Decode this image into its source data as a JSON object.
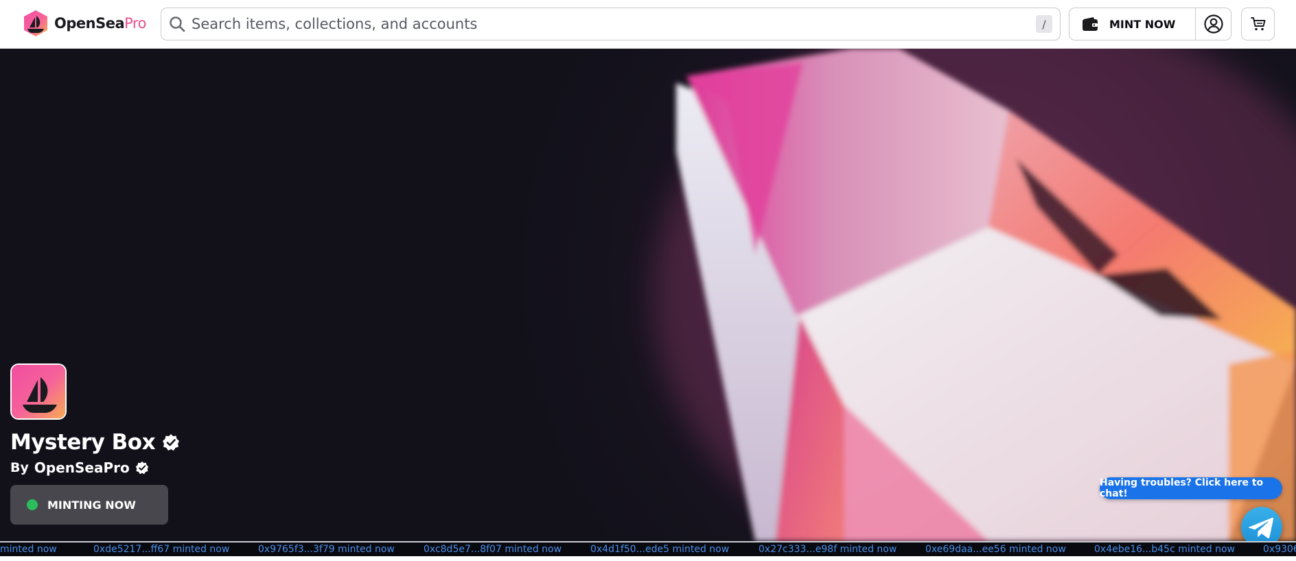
{
  "header": {
    "logo": {
      "brand": "OpenSea",
      "suffix": "Pro"
    },
    "search": {
      "placeholder": "Search items, collections, and accounts",
      "value": "",
      "shortcut": "/"
    },
    "mint_button_label": "MINT NOW",
    "icons": {
      "logo": "opensea-pro-logo",
      "search": "search-icon",
      "wallet": "wallet-icon",
      "account": "account-circle-icon",
      "cart": "cart-icon"
    }
  },
  "hero": {
    "collection_title": "Mystery Box",
    "creator_prefix": "By",
    "creator_name": "OpenSeaPro",
    "status_label": "MINTING NOW",
    "colors": {
      "background": "#12111a",
      "status_dot": "#2bbd5c",
      "status_pill": "#47474d",
      "gem_pink": "#e8509a",
      "gem_orange": "#f59a4a"
    }
  },
  "support": {
    "chat_prompt": "Having troubles? Click here to chat!",
    "chat_color": "#1a73e8",
    "telegram_icon": "telegram-icon"
  },
  "ticker": {
    "color": "#4a8ee8",
    "items": [
      "minted now",
      "0xde5217...ff67 minted now",
      "0x9765f3...3f79 minted now",
      "0xc8d5e7...8f07 minted now",
      "0x4d1f50...ede5 minted now",
      "0x27c333...e98f minted now",
      "0xe69daa...ee56 minted now",
      "0x4ebe16...b45c minted now",
      "0x9306"
    ]
  }
}
